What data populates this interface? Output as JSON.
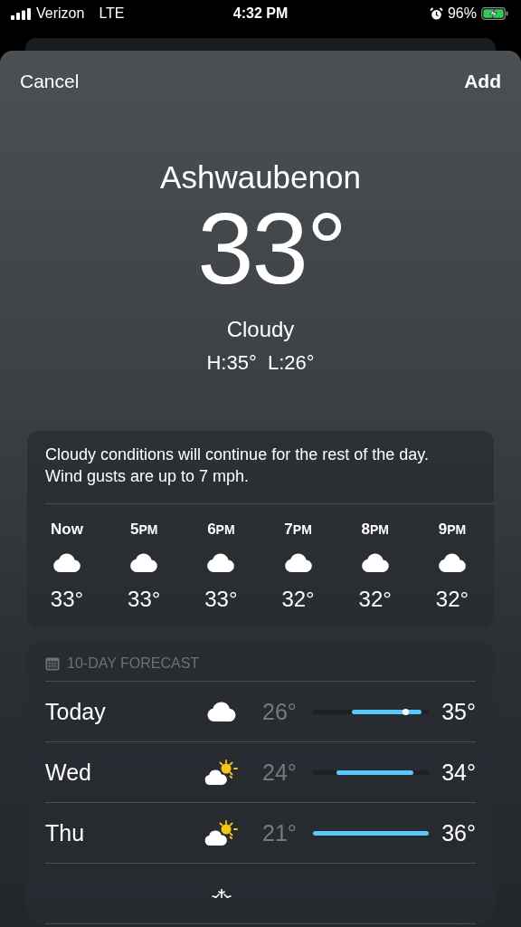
{
  "status_bar": {
    "carrier": "Verizon",
    "network": "LTE",
    "time": "4:32 PM",
    "battery": "96%",
    "charging": true,
    "alarm": true
  },
  "nav": {
    "cancel": "Cancel",
    "add": "Add"
  },
  "current": {
    "city": "Ashwaubenon",
    "temperature": "33°",
    "condition": "Cloudy",
    "high_low": "H:35°  L:26°"
  },
  "hourly": {
    "summary": "Cloudy conditions will continue for the rest of the day. Wind gusts are up to 7 mph.",
    "hours": [
      {
        "hour": "Now",
        "kind": "cloud",
        "temp": "33°"
      },
      {
        "hour": "5",
        "period": "PM",
        "kind": "cloud",
        "temp": "33°"
      },
      {
        "hour": "6",
        "period": "PM",
        "kind": "cloud",
        "temp": "33°"
      },
      {
        "hour": "7",
        "period": "PM",
        "kind": "cloud",
        "temp": "32°"
      },
      {
        "hour": "8",
        "period": "PM",
        "kind": "cloud",
        "temp": "32°"
      },
      {
        "hour": "9",
        "period": "PM",
        "kind": "cloud",
        "temp": "32°"
      }
    ]
  },
  "forecast": {
    "title": "10-DAY FORECAST",
    "days": [
      {
        "day": "Today",
        "kind": "cloud",
        "low": "26°",
        "high": "35°",
        "now": true
      },
      {
        "day": "Wed",
        "kind": "partly-sunny",
        "low": "24°",
        "high": "34°",
        "now": false
      },
      {
        "day": "Thu",
        "kind": "partly-sunny",
        "low": "21°",
        "high": "36°",
        "now": false
      },
      {
        "kind": "snow"
      }
    ]
  }
}
